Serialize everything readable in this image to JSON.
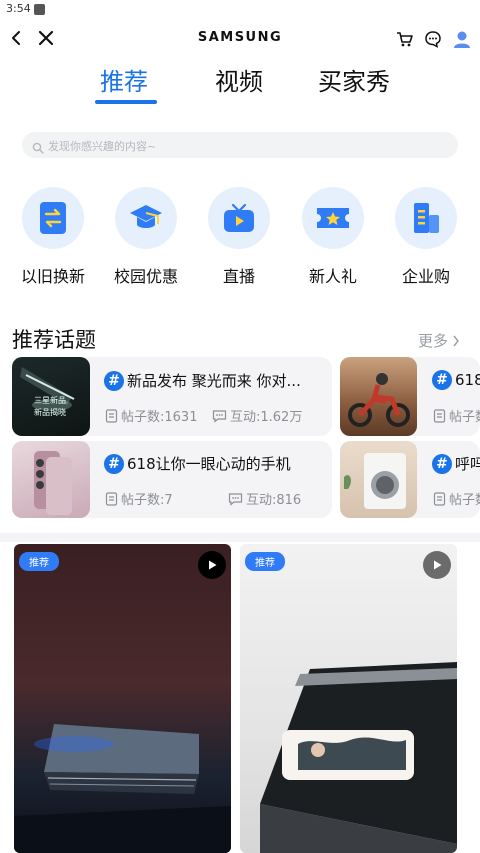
{
  "status": {
    "time": "3:54"
  },
  "header": {
    "brand": "SAMSUNG"
  },
  "tabs": [
    {
      "label": "推荐",
      "active": true
    },
    {
      "label": "视频",
      "active": false
    },
    {
      "label": "买家秀",
      "active": false
    }
  ],
  "search": {
    "placeholder": "发现你感兴趣的内容~"
  },
  "quick_links": [
    {
      "label": "以旧换新",
      "icon": "exchange-icon"
    },
    {
      "label": "校园优惠",
      "icon": "graduation-cap-icon"
    },
    {
      "label": "直播",
      "icon": "tv-icon"
    },
    {
      "label": "新人礼",
      "icon": "ticket-icon"
    },
    {
      "label": "企业购",
      "icon": "building-icon"
    }
  ],
  "topics_section": {
    "title": "推荐话题",
    "more": "更多",
    "cards": [
      {
        "title": "新品发布 聚光而来 你对...",
        "posts": "帖子数:1631",
        "interactions": "互动:1.62万",
        "thumb_text_1": "三星新品",
        "thumb_text_2": "新品揭晓"
      },
      {
        "title": "618让你一眼心动的手机",
        "posts": "帖子数:7",
        "interactions": "互动:816"
      },
      {
        "title": "618",
        "posts": "帖子数"
      },
      {
        "title": "呼吗",
        "posts": "帖子数"
      }
    ]
  },
  "feed": [
    {
      "badge": "推荐"
    },
    {
      "badge": "推荐"
    }
  ],
  "colors": {
    "accent": "#1b73e8",
    "icon_bg": "#e6f0fd",
    "card_bg": "#f4f4f6"
  }
}
